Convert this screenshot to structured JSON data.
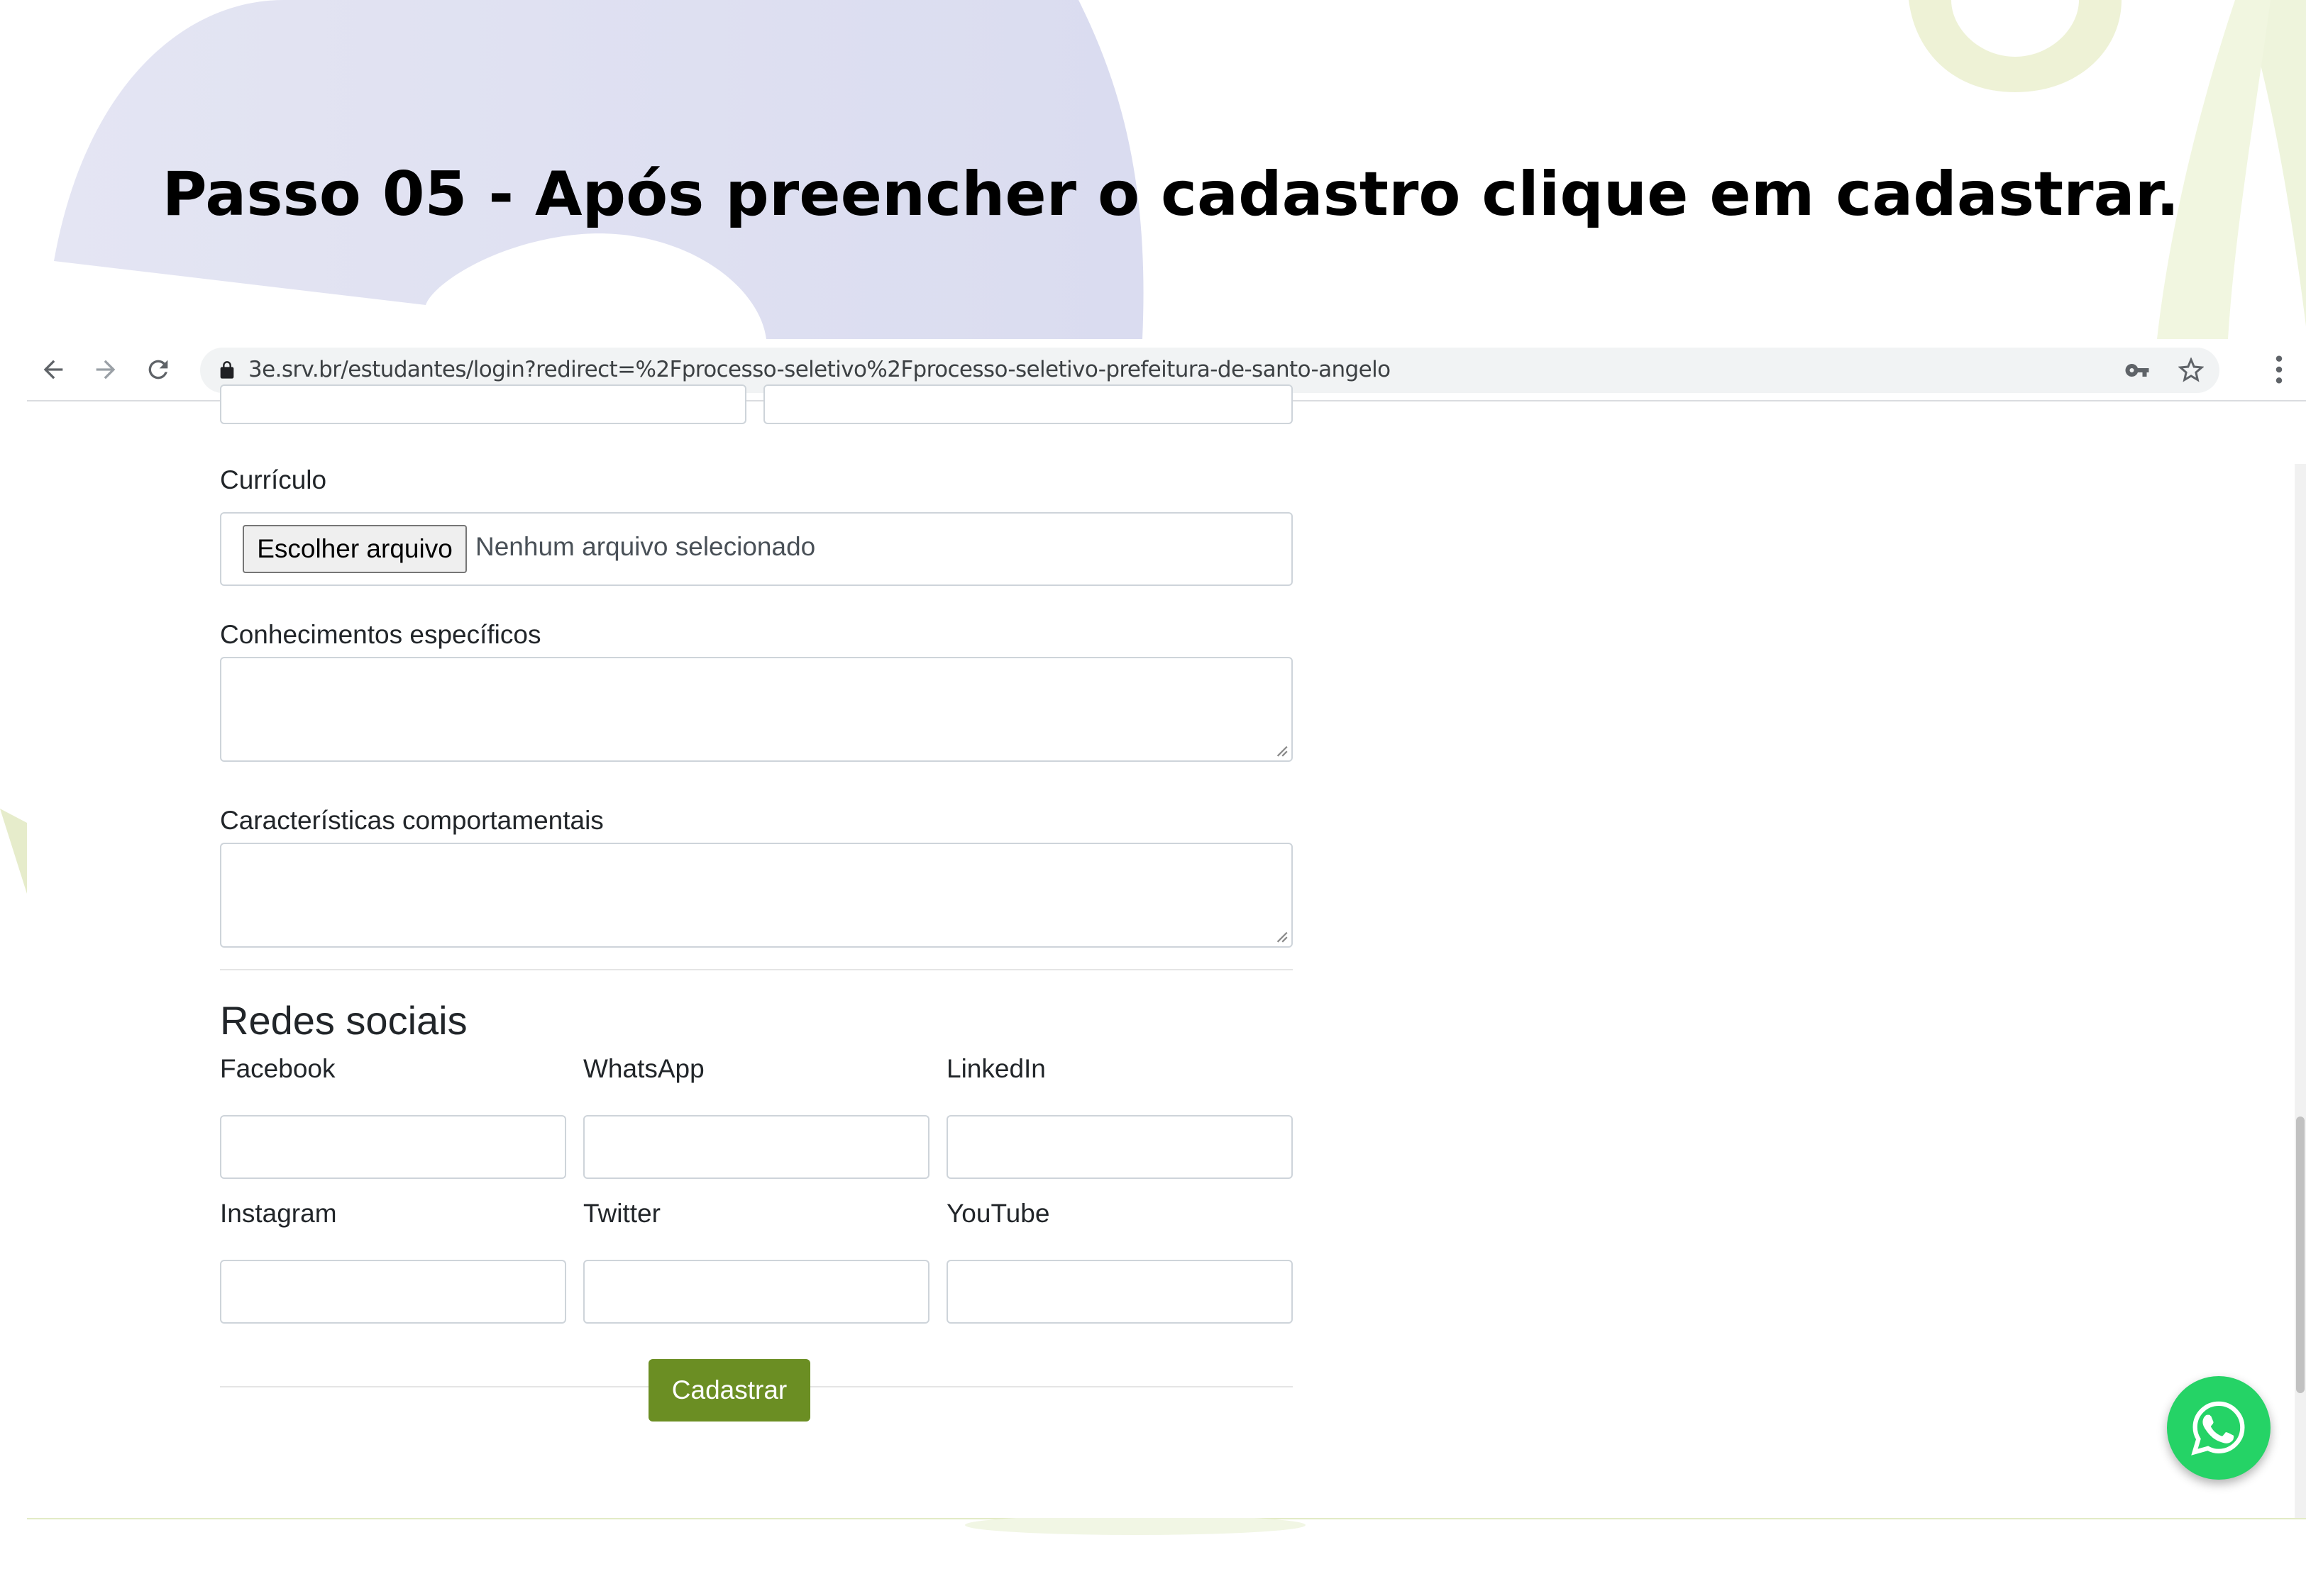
{
  "slide": {
    "title": "Passo 05 -  Após preencher o cadastro clique em cadastrar."
  },
  "browser": {
    "url": "3e.srv.br/estudantes/login?redirect=%2Fprocesso-seletivo%2Fprocesso-seletivo-prefeitura-de-santo-angelo"
  },
  "form": {
    "curriculo_label": "Currículo",
    "file_button_label": "Escolher arquivo",
    "file_status": "Nenhum arquivo selecionado",
    "conhecimentos_label": "Conhecimentos específicos",
    "caracteristicas_label": "Características comportamentais",
    "social_section_title": "Redes sociais",
    "social_fields": [
      "Facebook",
      "WhatsApp",
      "LinkedIn",
      "Instagram",
      "Twitter",
      "YouTube"
    ],
    "submit_label": "Cadastrar"
  },
  "colors": {
    "submit_bg": "#6b8e23",
    "whatsapp_green": "#25d366"
  }
}
